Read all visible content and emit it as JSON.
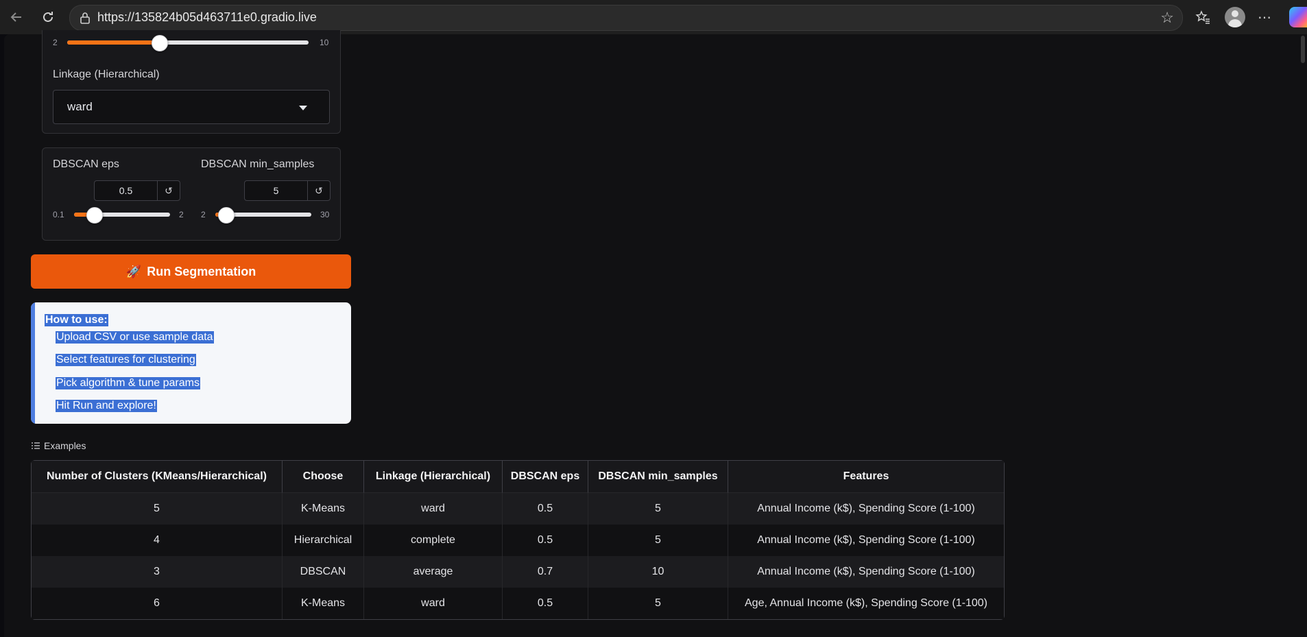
{
  "browser": {
    "url": "https://135824b05d463711e0.gradio.live"
  },
  "clusters_slider": {
    "min": "2",
    "max": "10",
    "fraction": 0.38
  },
  "linkage": {
    "label": "Linkage (Hierarchical)",
    "value": "ward"
  },
  "dbscan_eps": {
    "label": "DBSCAN eps",
    "value": "0.5",
    "min": "0.1",
    "max": "2",
    "fraction": 0.21
  },
  "dbscan_min_samples": {
    "label": "DBSCAN min_samples",
    "value": "5",
    "min": "2",
    "max": "30",
    "fraction": 0.11
  },
  "reset_icon": "↺",
  "run_button": {
    "icon": "🚀",
    "label": "Run Segmentation"
  },
  "howto": {
    "title": "How to use:",
    "items": [
      "Upload CSV or use sample data",
      "Select features for clustering",
      "Pick algorithm & tune params",
      "Hit Run and explore!"
    ]
  },
  "examples": {
    "label": "Examples",
    "columns": [
      "Number of Clusters (KMeans/Hierarchical)",
      "Choose",
      "Linkage (Hierarchical)",
      "DBSCAN eps",
      "DBSCAN min_samples",
      "Features"
    ],
    "rows": [
      [
        "5",
        "K-Means",
        "ward",
        "0.5",
        "5",
        "Annual Income (k$), Spending Score (1-100)"
      ],
      [
        "4",
        "Hierarchical",
        "complete",
        "0.5",
        "5",
        "Annual Income (k$), Spending Score (1-100)"
      ],
      [
        "3",
        "DBSCAN",
        "average",
        "0.7",
        "10",
        "Annual Income (k$), Spending Score (1-100)"
      ],
      [
        "6",
        "K-Means",
        "ward",
        "0.5",
        "5",
        "Age, Annual Income (k$), Spending Score (1-100)"
      ]
    ]
  },
  "colors": {
    "accent": "#ea580c",
    "slider": "#f97316",
    "background": "#111113"
  }
}
